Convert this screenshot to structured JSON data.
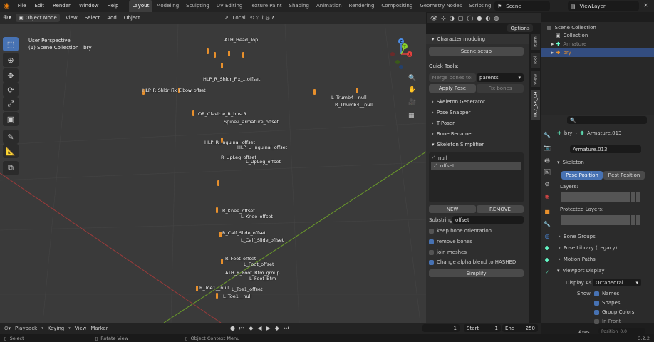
{
  "topbar": {
    "menus": [
      "File",
      "Edit",
      "Render",
      "Window",
      "Help"
    ],
    "workspaces": [
      "Layout",
      "Modeling",
      "Sculpting",
      "UV Editing",
      "Texture Paint",
      "Shading",
      "Animation",
      "Rendering",
      "Compositing",
      "Geometry Nodes",
      "Scripting"
    ],
    "active_workspace": "Layout",
    "add_tab": "+",
    "scene": "Scene",
    "view_layer": "ViewLayer"
  },
  "viewport_header": {
    "mode": "Object Mode",
    "menus": [
      "View",
      "Select",
      "Add",
      "Object"
    ],
    "transform_orientation": "Local",
    "options": "Options"
  },
  "viewport": {
    "perspective": "User Perspective",
    "collection_info": "(1) Scene Collection | bry",
    "gizmo_axes": [
      "Z",
      "Y",
      "X"
    ],
    "bone_labels": [
      "ATH_Head_Top",
      "HLP_R_Shldr_Fix_...offset",
      "HLP_R_Shldr_Fix_Elbow_offset",
      "L_Trumb4__null",
      "R_Thumb4__null",
      "OR_Clavicle_R_bustR",
      "Spine2_armature_offset",
      "HLP_R_Inguinal_offset",
      "HLP_L_Inguinal_offset",
      "R_UpLeg_offset",
      "L_UpLeg_offset",
      "R_Knee_offset",
      "L_Knee_offset",
      "R_Calf_Slide_offset",
      "L_Calf_Slide_offset",
      "R_Foot_offset",
      "L_Foot_offset",
      "ATH_R_Foot_Btm_group",
      "L_Foot_Btm",
      "R_Toe1__null",
      "L_Toe1_offset",
      "L_Toe1__null"
    ]
  },
  "npanel": {
    "header": "Character modding",
    "scene_setup": "Scene setup",
    "quick_tools_label": "Quick Tools:",
    "merge_bones_to": "Merge bones to:",
    "merge_target": "parents",
    "apply_pose": "Apply Pose",
    "fix_bones": "Fix bones",
    "sections": [
      "Skeleton Generator",
      "Pose Snapper",
      "T-Poser",
      "Bone Renamer",
      "Skeleton Simplifier"
    ],
    "list_items": [
      "null",
      "offset"
    ],
    "selected_list_item": "offset",
    "new_button": "NEW",
    "remove_button": "REMOVE",
    "substring_label": "Substring:",
    "substring_value": "offset",
    "options": [
      {
        "label": "keep bone orientation",
        "checked": false
      },
      {
        "label": "remove bones",
        "checked": true
      },
      {
        "label": "join meshes",
        "checked": false
      },
      {
        "label": "Change alpha blend to HASHED",
        "checked": true
      }
    ],
    "simplify_button": "Simplify"
  },
  "side_tabs": [
    "Item",
    "Tool",
    "View",
    "TK7_SK_CH"
  ],
  "outliner": {
    "items": [
      {
        "label": "Scene Collection",
        "depth": 0
      },
      {
        "label": "Collection",
        "depth": 1
      },
      {
        "label": "Armature",
        "depth": 1
      },
      {
        "label": "bry",
        "depth": 1
      }
    ]
  },
  "properties": {
    "breadcrumb_object": "bry",
    "breadcrumb_data": "Armature.013",
    "data_name": "Armature.013",
    "skeleton_header": "Skeleton",
    "pose_position": "Pose Position",
    "rest_position": "Rest Position",
    "layers_label": "Layers:",
    "protected_layers_label": "Protected Layers:",
    "panels": [
      "Bone Groups",
      "Pose Library (Legacy)",
      "Motion Paths"
    ],
    "viewport_display_header": "Viewport Display",
    "display_as_label": "Display As",
    "display_as_value": "Octahedral",
    "show_label": "Show",
    "show_options": [
      {
        "label": "Names",
        "checked": true
      },
      {
        "label": "Shapes",
        "checked": true
      },
      {
        "label": "Group Colors",
        "checked": true
      },
      {
        "label": "In Front",
        "checked": false
      }
    ],
    "axes_label": "Axes",
    "position_label": "Position",
    "position_value": "0.0"
  },
  "timeline": {
    "menus": [
      "Playback",
      "Keying",
      "View",
      "Marker"
    ],
    "current_frame": "1",
    "start_label": "Start",
    "start_value": "1",
    "end_label": "End",
    "end_value": "250"
  },
  "statusbar": {
    "items": [
      "Select",
      "Rotate View",
      "Object Context Menu"
    ],
    "version": "3.2.2"
  },
  "colors": {
    "accent_blue": "#4772b3",
    "bone_orange": "#e8902c",
    "axis_x": "#e2413e",
    "axis_y": "#8ad12b",
    "axis_z": "#4c8ee8"
  }
}
